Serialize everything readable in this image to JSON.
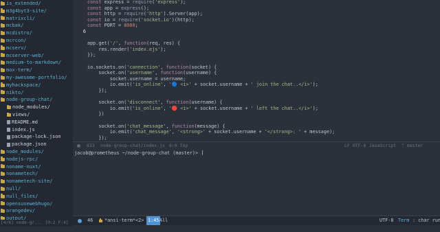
{
  "sidebar": {
    "entries": [
      {
        "label": "is_extended/",
        "kind": "dir",
        "depth": 0
      },
      {
        "label": "m3g4byt3-site/",
        "kind": "dir",
        "depth": 0
      },
      {
        "label": "matrixcli/",
        "kind": "dir",
        "depth": 0
      },
      {
        "label": "mcbak/",
        "kind": "dir",
        "depth": 0
      },
      {
        "label": "mcdistro/",
        "kind": "dir",
        "depth": 0
      },
      {
        "label": "mcrcon/",
        "kind": "dir",
        "depth": 0
      },
      {
        "label": "mcserv/",
        "kind": "dir",
        "depth": 0
      },
      {
        "label": "mcserver-web/",
        "kind": "dir",
        "depth": 0
      },
      {
        "label": "medium-to-markdown/",
        "kind": "dir",
        "depth": 0
      },
      {
        "label": "mox-term/",
        "kind": "dir",
        "depth": 0
      },
      {
        "label": "my-awesome-portfolio/",
        "kind": "dir",
        "depth": 0
      },
      {
        "label": "myhackspace/",
        "kind": "dir",
        "depth": 0
      },
      {
        "label": "nikto/",
        "kind": "dir",
        "depth": 0
      },
      {
        "label": "node-group-chat/",
        "kind": "dir",
        "depth": 0
      },
      {
        "label": "node_modules/",
        "kind": "sub",
        "depth": 1
      },
      {
        "label": "views/",
        "kind": "sub",
        "depth": 1
      },
      {
        "label": "README.md",
        "kind": "file",
        "depth": 1
      },
      {
        "label": "index.js",
        "kind": "file",
        "depth": 1
      },
      {
        "label": "package-lock.json",
        "kind": "file",
        "depth": 1
      },
      {
        "label": "package.json",
        "kind": "file",
        "depth": 1
      },
      {
        "label": "node_modules/",
        "kind": "dir",
        "depth": 0
      },
      {
        "label": "nodejs-rpc/",
        "kind": "dir",
        "depth": 0
      },
      {
        "label": "noname-nuxt/",
        "kind": "dir",
        "depth": 0
      },
      {
        "label": "nonametech/",
        "kind": "dir",
        "depth": 0
      },
      {
        "label": "nonametech-site/",
        "kind": "dir",
        "depth": 0
      },
      {
        "label": "null/",
        "kind": "dir",
        "depth": 0
      },
      {
        "label": "null_files/",
        "kind": "dir",
        "depth": 0
      },
      {
        "label": "opensusewebhugo/",
        "kind": "dir",
        "depth": 0
      },
      {
        "label": "orangedev/",
        "kind": "dir",
        "depth": 0
      },
      {
        "label": "output/",
        "kind": "dir",
        "depth": 0
      },
      {
        "label": "pam_usb/",
        "kind": "dir",
        "depth": 0
      }
    ],
    "status": "[4/6] node-gr... [0:2 F:4]"
  },
  "editor": {
    "lines": [
      {
        "num": "",
        "segments": [
          [
            "kw",
            "const "
          ],
          [
            "op",
            "express = "
          ],
          [
            "fn",
            "require"
          ],
          [
            "op",
            "("
          ],
          [
            "str",
            "'express'"
          ],
          [
            "op",
            ");"
          ]
        ]
      },
      {
        "num": "",
        "segments": [
          [
            "kw",
            "const "
          ],
          [
            "op",
            "app = "
          ],
          [
            "fn",
            "express"
          ],
          [
            "op",
            "();"
          ]
        ]
      },
      {
        "num": "",
        "segments": [
          [
            "kw",
            "const "
          ],
          [
            "op",
            "http = "
          ],
          [
            "fn",
            "require"
          ],
          [
            "op",
            "("
          ],
          [
            "str",
            "'http'"
          ],
          [
            "op",
            ").Server(app);"
          ]
        ]
      },
      {
        "num": "",
        "segments": [
          [
            "kw",
            "const "
          ],
          [
            "op",
            "io = "
          ],
          [
            "fn",
            "require"
          ],
          [
            "op",
            "("
          ],
          [
            "str",
            "'socket.io'"
          ],
          [
            "op",
            ")(http);"
          ]
        ]
      },
      {
        "num": "",
        "segments": [
          [
            "kw",
            "const "
          ],
          [
            "op",
            "PORT = "
          ],
          [
            "num",
            "8080"
          ],
          [
            "op",
            ";"
          ]
        ]
      },
      {
        "num": "6",
        "current": true,
        "segments": []
      },
      {
        "num": "",
        "segments": []
      },
      {
        "num": "",
        "segments": [
          [
            "op",
            "app.get("
          ],
          [
            "str",
            "'/'"
          ],
          [
            "op",
            ", "
          ],
          [
            "kw",
            "function"
          ],
          [
            "op",
            "(req, res) {"
          ]
        ]
      },
      {
        "num": "",
        "segments": [
          [
            "op",
            "    res.render("
          ],
          [
            "str",
            "'index.ejs'"
          ],
          [
            "op",
            ");"
          ]
        ]
      },
      {
        "num": "",
        "segments": [
          [
            "op",
            "});"
          ]
        ]
      },
      {
        "num": "",
        "segments": []
      },
      {
        "num": "",
        "segments": [
          [
            "op",
            "io.sockets.on("
          ],
          [
            "str",
            "'connection'"
          ],
          [
            "op",
            ", "
          ],
          [
            "kw",
            "function"
          ],
          [
            "op",
            "(socket) {"
          ]
        ]
      },
      {
        "num": "",
        "segments": [
          [
            "op",
            "    socket.on("
          ],
          [
            "str",
            "'username'"
          ],
          [
            "op",
            ", "
          ],
          [
            "kw",
            "function"
          ],
          [
            "op",
            "(username) {"
          ]
        ]
      },
      {
        "num": "",
        "segments": [
          [
            "op",
            "        socket.username = username;"
          ]
        ]
      },
      {
        "num": "",
        "segments": [
          [
            "op",
            "        io.emit("
          ],
          [
            "str",
            "'is_online'"
          ],
          [
            "op",
            ", "
          ],
          [
            "str",
            "'🔵 <i>'"
          ],
          [
            "op",
            " + socket.username + "
          ],
          [
            "str",
            "' join the chat..</i>'"
          ],
          [
            "op",
            ");"
          ]
        ]
      },
      {
        "num": "",
        "segments": [
          [
            "op",
            "    });"
          ]
        ]
      },
      {
        "num": "",
        "segments": []
      },
      {
        "num": "",
        "segments": [
          [
            "op",
            "    socket.on("
          ],
          [
            "str",
            "'disconnect'"
          ],
          [
            "op",
            ", "
          ],
          [
            "kw",
            "function"
          ],
          [
            "op",
            "(username) {"
          ]
        ]
      },
      {
        "num": "",
        "segments": [
          [
            "op",
            "        io.emit("
          ],
          [
            "str",
            "'is_online'"
          ],
          [
            "op",
            ", "
          ],
          [
            "str",
            "'🔴 <i>'"
          ],
          [
            "op",
            " + socket.username + "
          ],
          [
            "str",
            "' left the chat..</i>'"
          ],
          [
            "op",
            ");"
          ]
        ]
      },
      {
        "num": "",
        "segments": [
          [
            "op",
            "    })"
          ]
        ]
      },
      {
        "num": "",
        "segments": []
      },
      {
        "num": "",
        "segments": [
          [
            "op",
            "    socket.on("
          ],
          [
            "str",
            "'chat_message'"
          ],
          [
            "op",
            ", "
          ],
          [
            "kw",
            "function"
          ],
          [
            "op",
            "(message) {"
          ]
        ]
      },
      {
        "num": "",
        "segments": [
          [
            "op",
            "        io.emit("
          ],
          [
            "str",
            "'chat_message'"
          ],
          [
            "op",
            ", "
          ],
          [
            "str",
            "'<strong>'"
          ],
          [
            "op",
            " + socket.username + "
          ],
          [
            "str",
            "'</strong>: '"
          ],
          [
            "op",
            " + message);"
          ]
        ]
      },
      {
        "num": "",
        "segments": [
          [
            "op",
            "    });"
          ]
        ]
      },
      {
        "num": "",
        "segments": []
      },
      {
        "num": "",
        "segments": [
          [
            "op",
            "});"
          ]
        ]
      }
    ]
  },
  "editor_modeline": {
    "line_count": "833",
    "file_path": "node-group-chat/index.js",
    "position": "6:0 Top",
    "encoding": "LF UTF-8",
    "mode": "JavaScript",
    "branch": "ᛘ master"
  },
  "terminal": {
    "user_host": "jacob@prometheus",
    "path": " ~/node-group-chat",
    "branch": " (master)",
    "prompt_char": "> "
  },
  "bottom_modeline": {
    "line_count": "46",
    "buffer_name": "*ansi-term*<2>",
    "position": "1:45",
    "scroll": "All",
    "encoding": "UTF-8",
    "term_label": "Term",
    "mode": ": char run"
  },
  "colors": {
    "background": "#2b303b",
    "sidebar_bg": "#232832",
    "dir": "#5fb3d3",
    "string": "#a3be8c",
    "keyword": "#b48ead",
    "accent": "#4f94d4"
  }
}
